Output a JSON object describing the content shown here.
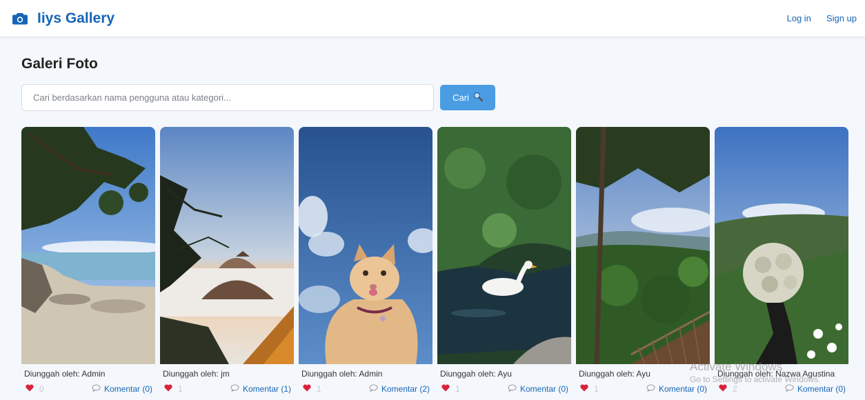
{
  "navbar": {
    "brand": "Iiys Gallery",
    "brand_icon": "camera-icon",
    "login": "Log in",
    "signup": "Sign up",
    "accent": "#1565b8"
  },
  "page": {
    "title": "Galeri Foto"
  },
  "search": {
    "placeholder": "Cari berdasarkan nama pengguna atau kategori...",
    "value": "",
    "button_label": "Cari",
    "button_icon": "magnifier-icon",
    "button_color": "#4a9de2"
  },
  "photos": [
    {
      "uploader": "Diunggah oleh: Admin",
      "likes": "0",
      "liked": true,
      "comments": "Komentar (0)",
      "image": "beach-tree"
    },
    {
      "uploader": "Diunggah oleh: jm",
      "likes": "1",
      "liked": true,
      "comments": "Komentar (1)",
      "image": "volcano-sunrise"
    },
    {
      "uploader": "Diunggah oleh: Admin",
      "likes": "1",
      "liked": true,
      "comments": "Komentar (2)",
      "image": "kitten-sky"
    },
    {
      "uploader": "Diunggah oleh: Ayu",
      "likes": "1",
      "liked": true,
      "comments": "Komentar (0)",
      "image": "duck-pond"
    },
    {
      "uploader": "Diunggah oleh: Ayu",
      "likes": "1",
      "liked": true,
      "comments": "Komentar (0)",
      "image": "forest-valley"
    },
    {
      "uploader": "Diunggah oleh: Nazwa Agustina",
      "likes": "2",
      "liked": true,
      "comments": "Komentar (0)",
      "image": "edelweiss-hand"
    }
  ],
  "watermark": {
    "line1": "Activate Windows",
    "line2": "Go to Settings to activate Windows."
  }
}
